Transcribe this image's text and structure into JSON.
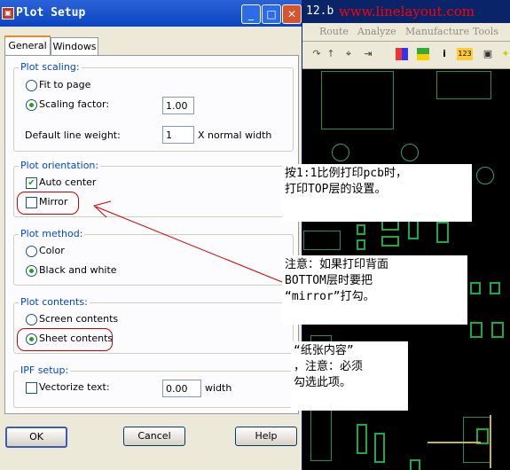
{
  "background_app": {
    "title_fragment": "12.b",
    "watermark": "www.linelayout.com",
    "menu": [
      "Route",
      "Analyze",
      "Manufacture",
      "Tools"
    ],
    "toolbar_icons": [
      "redo-icon",
      "arrow-up-icon",
      "pin-icon",
      "insert-icon",
      "color-grid-icon",
      "layers-icon",
      "info-icon",
      "numbers-icon",
      "snap-icon",
      "star-icon"
    ],
    "toolbar_numbers": "123"
  },
  "dialog": {
    "title": "Plot Setup",
    "title_buttons": {
      "minimize": "_",
      "maximize": "□",
      "close": "✕"
    },
    "tabs": [
      {
        "label": "General",
        "active": true
      },
      {
        "label": "Windows",
        "active": false
      }
    ],
    "plot_scaling": {
      "label": "Plot scaling:",
      "fit_to_page": {
        "label": "Fit to page",
        "selected": false
      },
      "scaling_factor": {
        "label": "Scaling factor:",
        "selected": true,
        "value": "1.00"
      },
      "default_line_weight": {
        "label": "Default line weight:",
        "value": "1",
        "suffix": "X normal width"
      }
    },
    "plot_orientation": {
      "label": "Plot orientation:",
      "auto_center": {
        "label": "Auto center",
        "checked": true
      },
      "mirror": {
        "label": "Mirror",
        "checked": false
      }
    },
    "plot_method": {
      "label": "Plot method:",
      "color": {
        "label": "Color",
        "selected": false
      },
      "black_and_white": {
        "label": "Black and white",
        "selected": true
      }
    },
    "plot_contents": {
      "label": "Plot contents:",
      "screen_contents": {
        "label": "Screen contents",
        "selected": false
      },
      "sheet_contents": {
        "label": "Sheet contents",
        "selected": true
      }
    },
    "ipf_setup": {
      "label": "IPF setup:",
      "vectorize_text": {
        "label": "Vectorize text:",
        "checked": false
      },
      "width_value": "0.00",
      "width_label": "width"
    },
    "buttons": {
      "ok": "OK",
      "cancel": "Cancel",
      "help": "Help"
    }
  },
  "annotations": {
    "note1": "按1:1比例打印pcb时，\n打印TOP层的设置。",
    "note2": "注意：如果打印背面\nBOTTOM层时要把\n“mirror”打勾。",
    "note3": "“纸张内容”\n，注意：必须\n勾选此项。"
  },
  "colors": {
    "title_bar": "#0a44c0",
    "group_label": "#0046d5",
    "highlight": "#cc0000",
    "watermark": "#ff0000"
  }
}
